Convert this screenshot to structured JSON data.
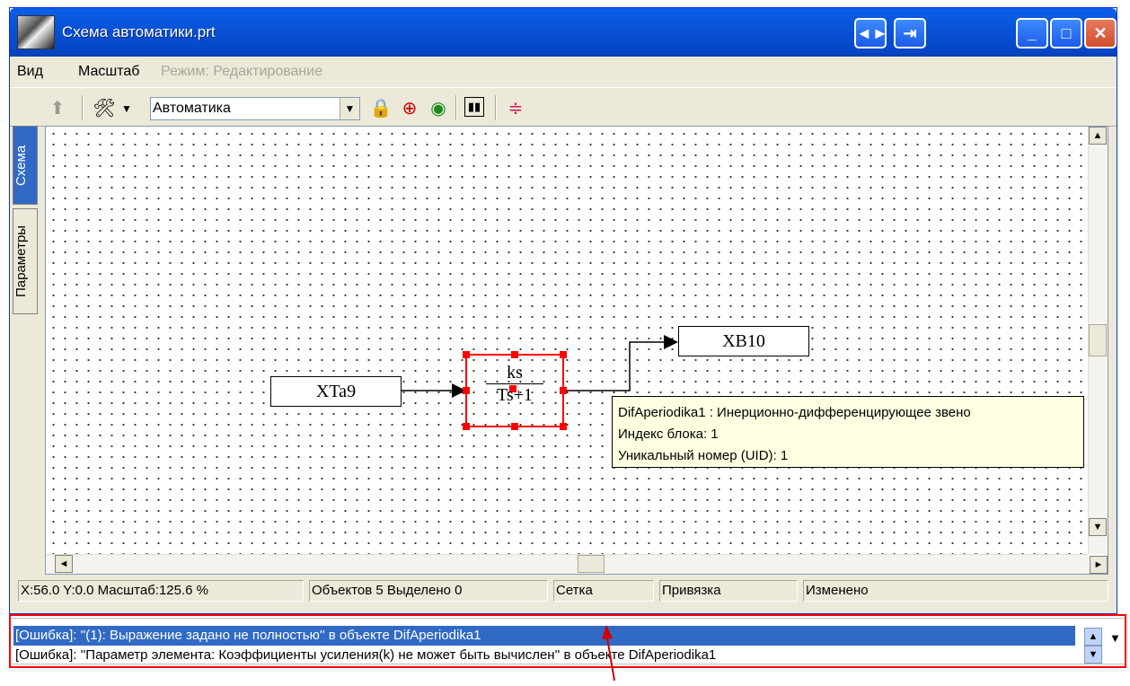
{
  "window": {
    "title": "Схема автоматики.prt",
    "extra_buttons": [
      "◄►",
      "⇥"
    ],
    "controls": {
      "minimize": "_",
      "maximize": "□",
      "close": "✕"
    }
  },
  "menu": {
    "items": [
      {
        "label": "Вид",
        "enabled": true
      },
      {
        "label": "Масштаб",
        "enabled": true
      },
      {
        "label": "Режим: Редактирование",
        "enabled": false
      }
    ]
  },
  "toolbar": {
    "mode_value": "Автоматика",
    "icons": [
      "up-arrow-icon",
      "tools-icon",
      "lock-icon",
      "zoom-icon",
      "target-icon",
      "pause-icon",
      "layers-icon"
    ]
  },
  "side_tabs": [
    "Схема",
    "Параметры"
  ],
  "diagram": {
    "block_input": "XTa9",
    "block_output": "XB10",
    "transfer_numerator": "ks",
    "transfer_denominator": "Ts+1"
  },
  "tooltip": {
    "line1": "DifAperiodika1 : Инерционно-дифференцирующее звено",
    "line2": "Индекс блока: 1",
    "line3": "Уникальный номер (UID): 1"
  },
  "status": {
    "coords": "X:56.0  Y:0.0  Масштаб:125.6 %",
    "objects": "Объектов 5  Выделено 0",
    "grid": "Сетка",
    "snap": "Привязка",
    "changed": "Изменено"
  },
  "messages": [
    "[Ошибка]:  ''(1): Выражение задано не полностью''  в объекте  DifAperiodika1",
    "[Ошибка]:  ''Параметр элемента: Коэффициенты усиления(k) не может быть вычислен''  в объекте  DifAperiodika1"
  ],
  "colors": {
    "selection": "#ff0000",
    "title_bar": "#0853d8",
    "tooltip_bg": "#ffffe1",
    "highlight": "#316ac5"
  }
}
